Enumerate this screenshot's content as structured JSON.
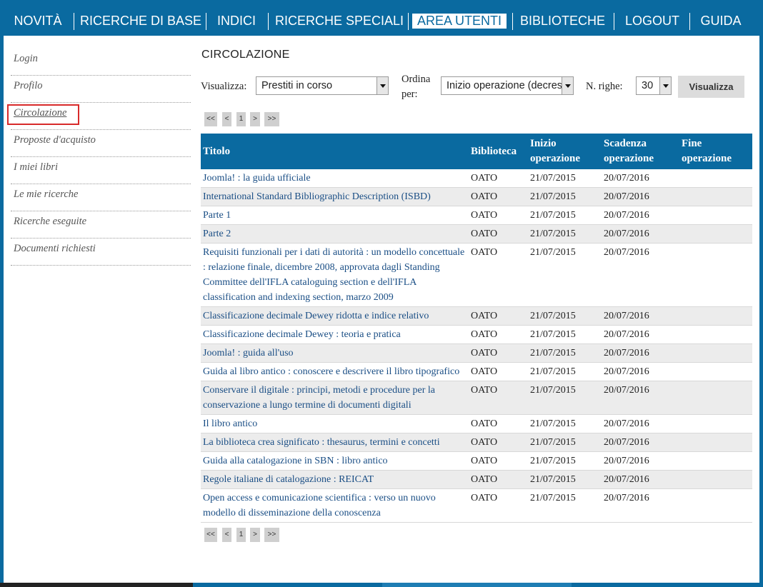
{
  "nav": {
    "items": [
      {
        "label": "NOVITÀ"
      },
      {
        "label": "RICERCHE DI BASE"
      },
      {
        "label": "INDICI"
      },
      {
        "label": "RICERCHE SPECIALI"
      },
      {
        "label": "AREA UTENTI",
        "active": true
      },
      {
        "label": "BIBLIOTECHE"
      },
      {
        "label": "LOGOUT"
      },
      {
        "label": "GUIDA"
      }
    ]
  },
  "sidebar": {
    "items": [
      {
        "label": "Login"
      },
      {
        "label": "Profilo"
      },
      {
        "label": "Circolazione",
        "active": true
      },
      {
        "label": "Proposte d'acquisto"
      },
      {
        "label": "I miei libri"
      },
      {
        "label": "Le mie ricerche"
      },
      {
        "label": "Ricerche eseguite"
      },
      {
        "label": "Documenti richiesti"
      }
    ]
  },
  "main": {
    "title": "CIRCOLAZIONE",
    "filters": {
      "visualizza_label": "Visualizza:",
      "visualizza_value": "Prestiti in corso",
      "ordina_label_1": "Ordina",
      "ordina_label_2": "per:",
      "ordina_value": "Inizio operazione (decrescente)",
      "righe_label": "N. righe:",
      "righe_value": "30",
      "button_label": "Visualizza"
    },
    "pager": {
      "first": "<<",
      "prev": "<",
      "page": "1",
      "next": ">",
      "last": ">>"
    },
    "table": {
      "headers": {
        "titolo": "Titolo",
        "biblioteca": "Biblioteca",
        "inizio": "Inizio operazione",
        "scadenza": "Scadenza operazione",
        "fine": "Fine operazione"
      },
      "rows": [
        {
          "titolo": "Joomla! : la guida ufficiale",
          "biblioteca": "OATO",
          "inizio": "21/07/2015",
          "scadenza": "20/07/2016",
          "fine": ""
        },
        {
          "titolo": "International Standard Bibliographic Description (ISBD)",
          "biblioteca": "OATO",
          "inizio": "21/07/2015",
          "scadenza": "20/07/2016",
          "fine": ""
        },
        {
          "titolo": "Parte 1",
          "biblioteca": "OATO",
          "inizio": "21/07/2015",
          "scadenza": "20/07/2016",
          "fine": ""
        },
        {
          "titolo": "Parte 2",
          "biblioteca": "OATO",
          "inizio": "21/07/2015",
          "scadenza": "20/07/2016",
          "fine": ""
        },
        {
          "titolo": "Requisiti funzionali per i dati di autorità : un modello concettuale : relazione finale, dicembre 2008, approvata dagli Standing Committee dell'IFLA cataloguing section e dell'IFLA classification and indexing section, marzo 2009",
          "biblioteca": "OATO",
          "inizio": "21/07/2015",
          "scadenza": "20/07/2016",
          "fine": ""
        },
        {
          "titolo": "Classificazione decimale Dewey ridotta e indice relativo",
          "biblioteca": "OATO",
          "inizio": "21/07/2015",
          "scadenza": "20/07/2016",
          "fine": ""
        },
        {
          "titolo": "Classificazione decimale Dewey : teoria e pratica",
          "biblioteca": "OATO",
          "inizio": "21/07/2015",
          "scadenza": "20/07/2016",
          "fine": ""
        },
        {
          "titolo": "Joomla! : guida all'uso",
          "biblioteca": "OATO",
          "inizio": "21/07/2015",
          "scadenza": "20/07/2016",
          "fine": ""
        },
        {
          "titolo": "Guida al libro antico : conoscere e descrivere il libro tipografico",
          "biblioteca": "OATO",
          "inizio": "21/07/2015",
          "scadenza": "20/07/2016",
          "fine": ""
        },
        {
          "titolo": "Conservare il digitale : principi, metodi e procedure per la conservazione a lungo termine di documenti digitali",
          "biblioteca": "OATO",
          "inizio": "21/07/2015",
          "scadenza": "20/07/2016",
          "fine": ""
        },
        {
          "titolo": "Il libro antico",
          "biblioteca": "OATO",
          "inizio": "21/07/2015",
          "scadenza": "20/07/2016",
          "fine": ""
        },
        {
          "titolo": "La biblioteca crea significato : thesaurus, termini e concetti",
          "biblioteca": "OATO",
          "inizio": "21/07/2015",
          "scadenza": "20/07/2016",
          "fine": ""
        },
        {
          "titolo": "Guida alla catalogazione in SBN : libro antico",
          "biblioteca": "OATO",
          "inizio": "21/07/2015",
          "scadenza": "20/07/2016",
          "fine": ""
        },
        {
          "titolo": "Regole italiane di catalogazione : REICAT",
          "biblioteca": "OATO",
          "inizio": "21/07/2015",
          "scadenza": "20/07/2016",
          "fine": ""
        },
        {
          "titolo": "Open access e comunicazione scientifica : verso un nuovo modello di disseminazione della conoscenza",
          "biblioteca": "OATO",
          "inizio": "21/07/2015",
          "scadenza": "20/07/2016",
          "fine": ""
        }
      ]
    }
  }
}
